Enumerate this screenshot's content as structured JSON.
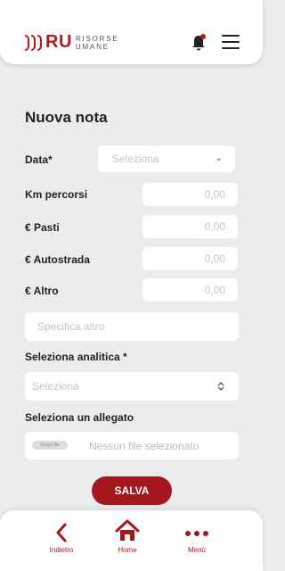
{
  "header": {
    "logo_text": "RU",
    "logo_sub_line1": "RISORSE",
    "logo_sub_line2": "UMANE"
  },
  "colors": {
    "brand": "#a5171e",
    "background": "#ececec"
  },
  "form": {
    "title": "Nuova nota",
    "data_label": "Data*",
    "data_placeholder": "Seleziona",
    "km_label": "Km percorsi",
    "km_value": "0,00",
    "pasti_label": "€ Pasti",
    "pasti_value": "0,00",
    "autostrada_label": "€ Autostrada",
    "autostrada_value": "0,00",
    "altro_label": "€ Altro",
    "altro_value": "0,00",
    "specifica_placeholder": "Specifica altro",
    "analitica_label": "Seleziona analitica *",
    "analitica_placeholder": "Seleziona",
    "allegato_label": "Seleziona un allegato",
    "file_button": "Scegli file",
    "file_status": "Nessun file selezionato",
    "save_label": "SALVA"
  },
  "bottom_nav": {
    "back_label": "Indietro",
    "home_label": "Home",
    "menu_label": "Menù"
  },
  "icons": [
    "bell-icon",
    "hamburger-icon",
    "chevron-down-icon",
    "sort-arrows-icon",
    "chevron-left-icon",
    "home-icon",
    "dots-icon"
  ]
}
